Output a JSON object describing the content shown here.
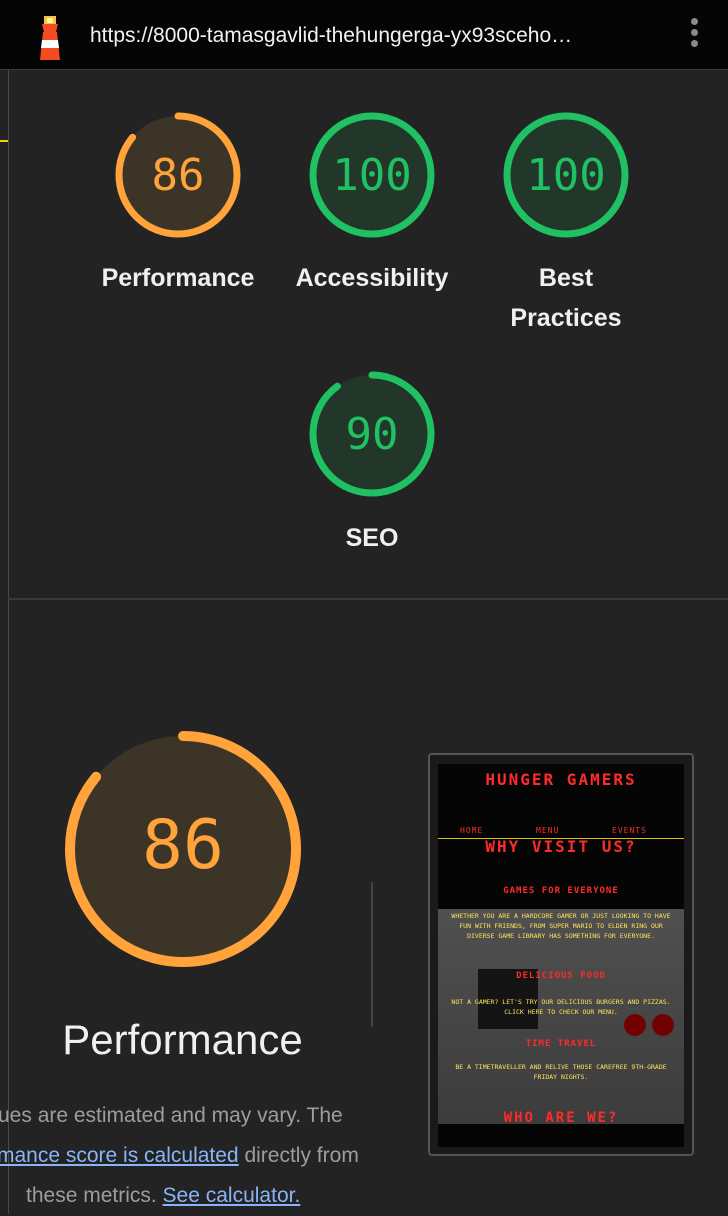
{
  "browser": {
    "url": "https://8000-tamasgavlid-thehungerga-yx93sceho…",
    "app_icon": "lighthouse-icon",
    "menu_icon": "kebab-menu-icon"
  },
  "summary_gauges": [
    {
      "id": "performance",
      "score": 86,
      "label": "Performance",
      "color": "#ffa33a"
    },
    {
      "id": "accessibility",
      "score": 100,
      "label": "Accessibility",
      "color": "#20c162"
    },
    {
      "id": "best-practices",
      "score": 100,
      "label_line1": "Best",
      "label_line2": "Practices",
      "color": "#20c162"
    },
    {
      "id": "seo",
      "score": 90,
      "label": "SEO",
      "color": "#20c162"
    }
  ],
  "performance_section": {
    "score": 86,
    "title": "Performance",
    "color": "#ffa33a",
    "desc_line1": "ues are estimated and may vary. The",
    "desc_link1": "mance score is calculated",
    "desc_line2_rest": " directly from",
    "desc_line3_text": "these metrics. ",
    "desc_link2": "See calculator."
  },
  "screenshot_preview": {
    "title": "HUNGER GAMERS",
    "nav": [
      "HOME",
      "MENU",
      "EVENTS"
    ],
    "heading": "WHY VISIT US?",
    "section1_title": "GAMES FOR EVERYONE",
    "section1_text": "WHETHER YOU ARE A HARDCORE GAMER OR JUST LOOKING TO HAVE FUN WITH FRIENDS, FROM SUPER MARIO TO ELDEN RING OUR DIVERSE GAME LIBRARY HAS SOMETHING FOR EVERYONE.",
    "section2_title": "DELICIOUS FOOD",
    "section2_text": "NOT A GAMER? LET'S TRY OUR DELICIOUS BURGERS AND PIZZAS. CLICK HERE TO CHECK OUR MENU.",
    "section3_title": "TIME TRAVEL",
    "section3_text": "BE A TIMETRAVELLER AND RELIVE THOSE CAREFREE 9TH-GRADE FRIDAY NIGHTS.",
    "footer_heading": "WHO ARE WE?"
  }
}
